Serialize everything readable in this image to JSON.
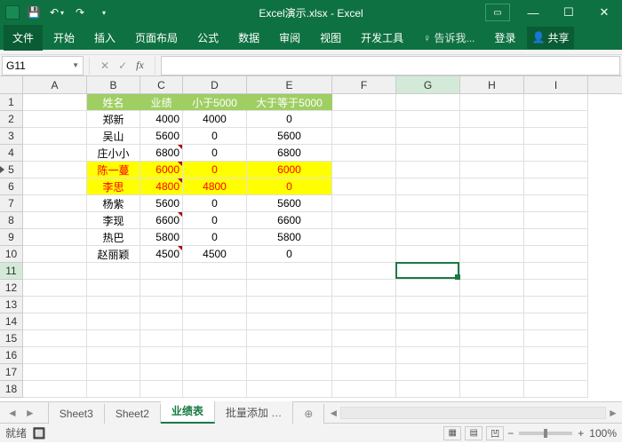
{
  "app": {
    "title": "Excel演示.xlsx - Excel"
  },
  "qat": {
    "save": "💾",
    "undo": "↶",
    "redo": "↷"
  },
  "win": {
    "min": "—",
    "max": "☐",
    "close": "✕",
    "ribopt": "▭"
  },
  "ribbon": {
    "file": "文件",
    "home": "开始",
    "insert": "插入",
    "layout": "页面布局",
    "formula": "公式",
    "data": "数据",
    "review": "审阅",
    "view": "视图",
    "dev": "开发工具",
    "tell": "告诉我...",
    "login": "登录",
    "share": "共享"
  },
  "namebox": "G11",
  "fx": {
    "cancel": "✕",
    "confirm": "✓",
    "fx": "fx"
  },
  "cols": [
    "A",
    "B",
    "C",
    "D",
    "E",
    "F",
    "G",
    "H",
    "I"
  ],
  "rowcount": 18,
  "headers": {
    "b": "姓名",
    "c": "业绩",
    "d": "小于5000",
    "e": "大于等于5000"
  },
  "data": [
    {
      "name": "郑新",
      "perf": "4000",
      "lt": "4000",
      "gte": "0",
      "hl": false,
      "tri": false
    },
    {
      "name": "吴山",
      "perf": "5600",
      "lt": "0",
      "gte": "5600",
      "hl": false,
      "tri": false
    },
    {
      "name": "庄小小",
      "perf": "6800",
      "lt": "0",
      "gte": "6800",
      "hl": false,
      "tri": true
    },
    {
      "name": "陈一蔓",
      "perf": "6000",
      "lt": "0",
      "gte": "6000",
      "hl": true,
      "tri": true
    },
    {
      "name": "李思",
      "perf": "4800",
      "lt": "4800",
      "gte": "0",
      "hl": true,
      "tri": true
    },
    {
      "name": "杨紫",
      "perf": "5600",
      "lt": "0",
      "gte": "5600",
      "hl": false,
      "tri": false
    },
    {
      "name": "李现",
      "perf": "6600",
      "lt": "0",
      "gte": "6600",
      "hl": false,
      "tri": true
    },
    {
      "name": "热巴",
      "perf": "5800",
      "lt": "0",
      "gte": "5800",
      "hl": false,
      "tri": false
    },
    {
      "name": "赵丽颖",
      "perf": "4500",
      "lt": "4500",
      "gte": "0",
      "hl": false,
      "tri": true
    }
  ],
  "tabs": {
    "nav": "…",
    "s3": "Sheet3",
    "s2": "Sheet2",
    "active": "业绩表",
    "s4": "批量添加",
    "new": "⊕"
  },
  "status": {
    "ready": "就绪",
    "zoom": "100%",
    "plus": "+",
    "minus": "−"
  }
}
